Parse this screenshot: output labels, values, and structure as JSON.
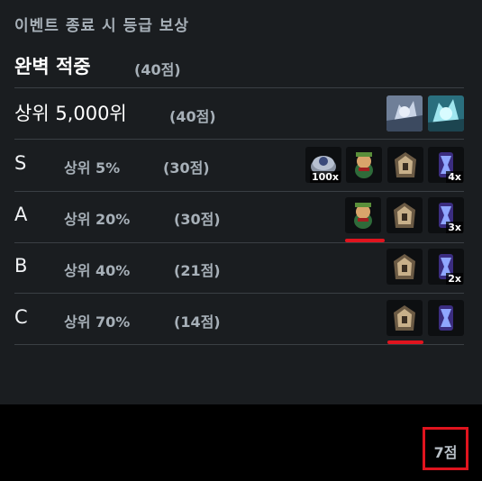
{
  "header": {
    "title": "이벤트 종료 시 등급 보상"
  },
  "perfect": {
    "label": "완벽 적중",
    "points": "(40점)"
  },
  "top5000": {
    "label": "상위 5,000위",
    "points": "(40점)",
    "rewards": [
      {
        "icon": "champion-portrait-1-icon"
      },
      {
        "icon": "champion-portrait-2-icon"
      }
    ]
  },
  "grades": [
    {
      "grade": "S",
      "rank": "상위 5%",
      "points": "(30점)",
      "rewards": [
        {
          "icon": "coin-stack-icon",
          "badge": "100x"
        },
        {
          "icon": "little-legend-icon",
          "badge": ""
        },
        {
          "icon": "treasure-chest-icon",
          "badge": ""
        },
        {
          "icon": "star-shard-icon",
          "badge": "4x"
        }
      ]
    },
    {
      "grade": "A",
      "rank": "상위 20%",
      "points": "(30점)",
      "rewards": [
        {
          "icon": "little-legend-icon",
          "badge": ""
        },
        {
          "icon": "treasure-chest-icon",
          "badge": ""
        },
        {
          "icon": "star-shard-icon",
          "badge": "3x"
        }
      ]
    },
    {
      "grade": "B",
      "rank": "상위 40%",
      "points": "(21점)",
      "rewards": [
        {
          "icon": "treasure-chest-icon",
          "badge": ""
        },
        {
          "icon": "star-shard-icon",
          "badge": "2x"
        }
      ]
    },
    {
      "grade": "C",
      "rank": "상위 70%",
      "points": "(14점)",
      "rewards": [
        {
          "icon": "treasure-chest-icon",
          "badge": ""
        },
        {
          "icon": "star-shard-icon",
          "badge": ""
        }
      ]
    }
  ],
  "footer": {
    "score": "7점"
  },
  "colors": {
    "panel": "#1a1d20",
    "text_muted": "#a7b0b8",
    "highlight": "#e0141e"
  }
}
